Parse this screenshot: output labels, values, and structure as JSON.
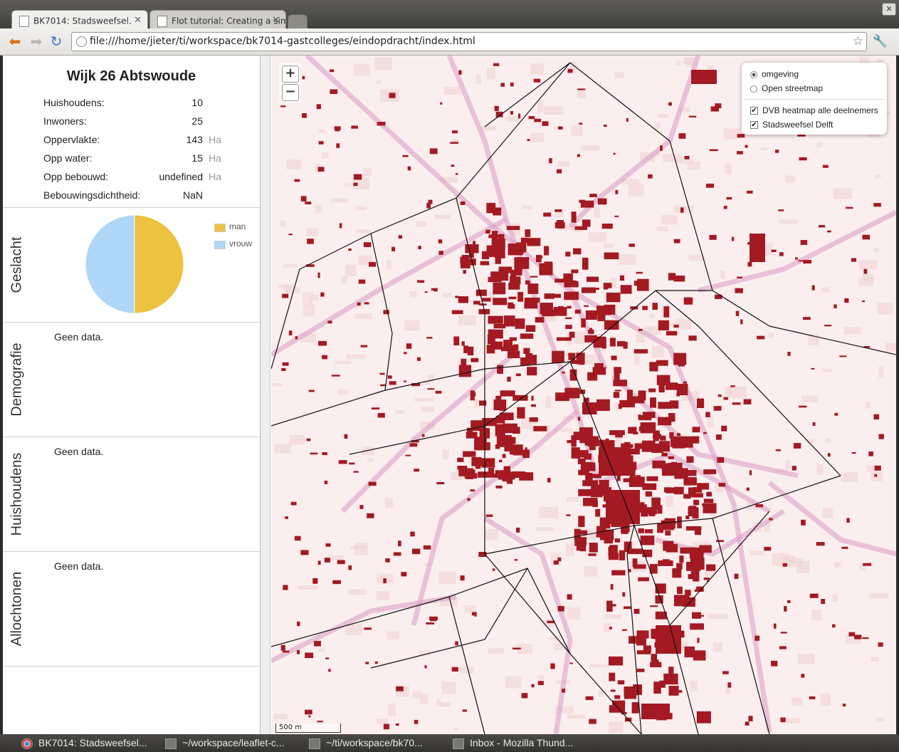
{
  "browser": {
    "tabs": [
      {
        "title": "BK7014: Stadsweefsel."
      },
      {
        "title": "Flot tutorial: Creating a sim"
      }
    ],
    "url": "file:///home/jieter/ti/workspace/bk7014-gastcolleges/eindopdracht/index.html",
    "icons": [
      "back-arrow-icon",
      "forward-arrow-icon",
      "reload-icon",
      "bookmark-star-icon",
      "wrench-icon"
    ]
  },
  "sidebar": {
    "title": "Wijk 26 Abtswoude",
    "stats": [
      {
        "label": "Huishoudens:",
        "value": "10",
        "unit": ""
      },
      {
        "label": "Inwoners:",
        "value": "25",
        "unit": ""
      },
      {
        "label": "Oppervlakte:",
        "value": "143",
        "unit": "Ha"
      },
      {
        "label": "Opp water:",
        "value": "15",
        "unit": "Ha"
      },
      {
        "label": "Opp bebouwd:",
        "value": "undefined",
        "unit": "Ha"
      },
      {
        "label": "Bebouwingsdichtheid:",
        "value": "NaN",
        "unit": ""
      }
    ],
    "sections": [
      {
        "label": "Geslacht"
      },
      {
        "label": "Demografie",
        "message": "Geen data."
      },
      {
        "label": "Huishoudens",
        "message": "Geen data."
      },
      {
        "label": "Allochtonen",
        "message": "Geen data."
      }
    ]
  },
  "chart_data": {
    "type": "pie",
    "labels": [
      "man",
      "vrouw"
    ],
    "values": [
      50,
      50
    ],
    "colors": [
      "#edc240",
      "#afd8f8"
    ]
  },
  "map": {
    "layers": {
      "base": [
        {
          "label": "omgeving",
          "checked": true
        },
        {
          "label": "Open streetmap",
          "checked": false
        }
      ],
      "overlays": [
        {
          "label": "DVB heatmap alle deelnemers",
          "checked": true
        },
        {
          "label": "Stadsweefsel Delft",
          "checked": true
        }
      ]
    },
    "zoom_in": "+",
    "zoom_out": "−",
    "scale": "500 m"
  },
  "taskbar": {
    "items": [
      {
        "label": "BK7014: Stadsweefsel...",
        "icon": "chrome-icon"
      },
      {
        "label": "~/workspace/leaflet-c...",
        "icon": "terminal-icon"
      },
      {
        "label": "~/ti/workspace/bk70...",
        "icon": "terminal-icon"
      },
      {
        "label": "Inbox - Mozilla Thund...",
        "icon": "thunderbird-icon"
      }
    ]
  }
}
